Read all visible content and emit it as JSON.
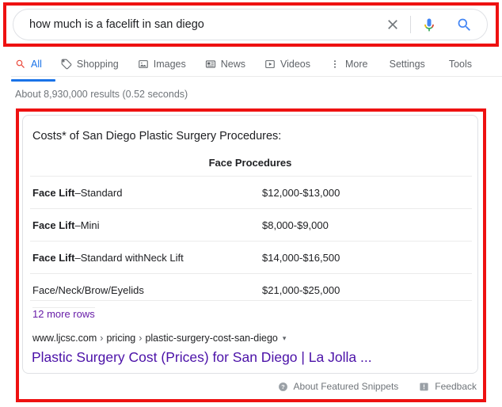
{
  "search": {
    "query": "how much is a facelift in san diego",
    "clear_icon": "close-icon",
    "mic_icon": "microphone-icon",
    "search_icon": "search-icon"
  },
  "nav": {
    "tabs": [
      {
        "label": "All",
        "icon": "search-icon",
        "active": true
      },
      {
        "label": "Shopping",
        "icon": "tag-icon",
        "active": false
      },
      {
        "label": "Images",
        "icon": "image-icon",
        "active": false
      },
      {
        "label": "News",
        "icon": "news-icon",
        "active": false
      },
      {
        "label": "Videos",
        "icon": "video-icon",
        "active": false
      },
      {
        "label": "More",
        "icon": "more-vert-icon",
        "active": false
      }
    ],
    "settings_label": "Settings",
    "tools_label": "Tools"
  },
  "result_stats": "About 8,930,000 results (0.52 seconds)",
  "snippet": {
    "title": "Costs* of San Diego Plastic Surgery Procedures:",
    "table_header": "Face Procedures",
    "rows": [
      {
        "bold": "Face Lift",
        "rest": "–Standard",
        "price": "$12,000-$13,000"
      },
      {
        "bold": "Face Lift",
        "rest": "–Mini",
        "price": "$8,000-$9,000"
      },
      {
        "bold": "Face Lift",
        "rest": "–Standard withNeck Lift",
        "price": "$14,000-$16,500"
      },
      {
        "bold": "",
        "rest": "Face/Neck/Brow/Eyelids",
        "price": "$21,000-$25,000"
      }
    ],
    "more_rows_label": "12 more rows",
    "url_domain": "www.ljcsc.com",
    "url_crumbs": [
      "pricing",
      "plastic-surgery-cost-san-diego"
    ],
    "url_caret": "▾",
    "result_title": "Plastic Surgery Cost (Prices) for San Diego | La Jolla ..."
  },
  "footer": {
    "about_label": "About Featured Snippets",
    "about_icon": "help-circle-icon",
    "feedback_label": "Feedback",
    "feedback_icon": "feedback-flag-icon"
  },
  "colors": {
    "google_blue": "#1a73e8",
    "visited_purple": "#4b11a8",
    "annotation_red": "#ee1111",
    "text_primary": "#202124",
    "text_secondary": "#5f6368"
  }
}
